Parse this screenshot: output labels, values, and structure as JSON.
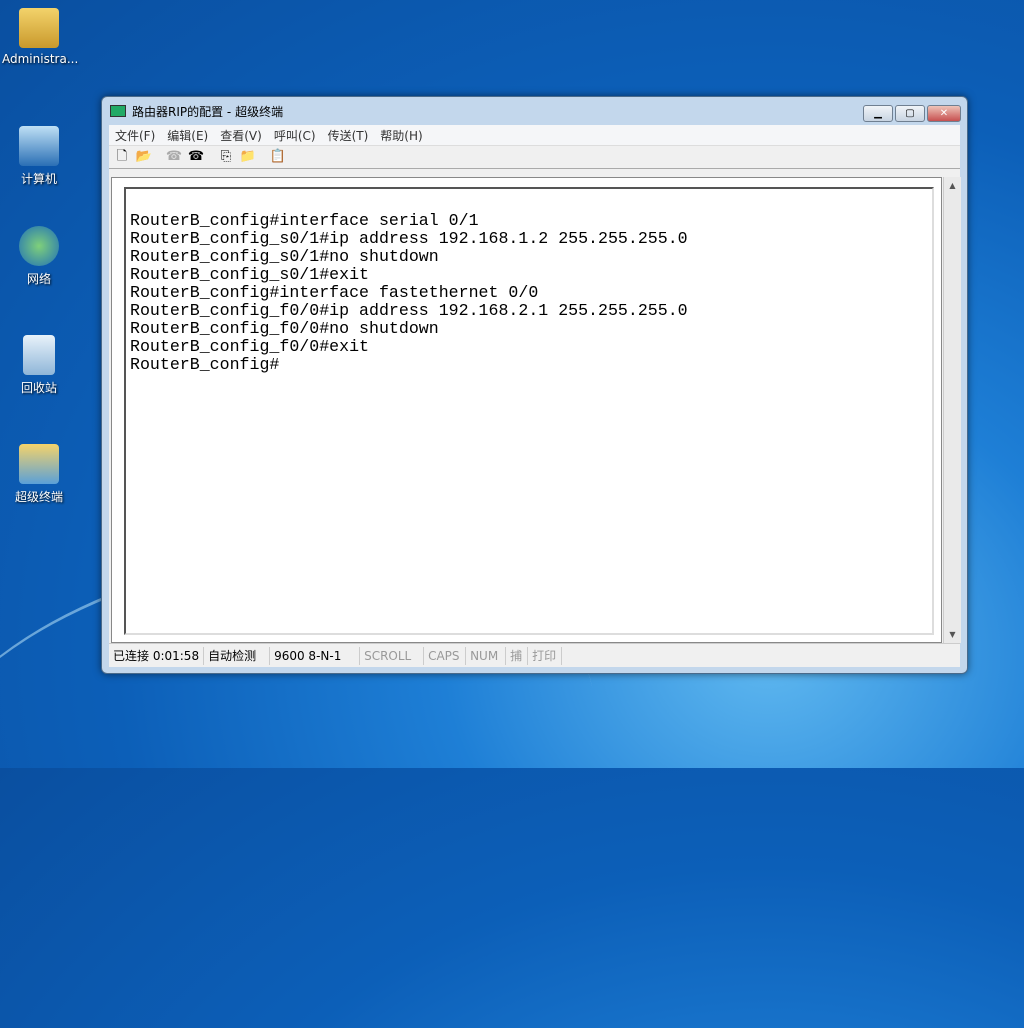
{
  "desktop": {
    "icons": [
      {
        "label": "Administra..."
      },
      {
        "label": "计算机"
      },
      {
        "label": "网络"
      },
      {
        "label": "回收站"
      },
      {
        "label": "超级终端"
      }
    ]
  },
  "window": {
    "title": "路由器RIP的配置 - 超级终端",
    "menu": [
      "文件(F)",
      "编辑(E)",
      "查看(V)",
      "呼叫(C)",
      "传送(T)",
      "帮助(H)"
    ],
    "toolbar": [
      "new-icon",
      "open-icon",
      "disconnect-icon",
      "dial-icon",
      "send-icon",
      "receive-icon",
      "properties-icon"
    ],
    "terminal_lines": [
      "RouterB_config#interface serial 0/1",
      "RouterB_config_s0/1#ip address 192.168.1.2 255.255.255.0",
      "RouterB_config_s0/1#no shutdown",
      "RouterB_config_s0/1#exit",
      "RouterB_config#interface fastethernet 0/0",
      "RouterB_config_f0/0#ip address 192.168.2.1 255.255.255.0",
      "RouterB_config_f0/0#no shutdown",
      "RouterB_config_f0/0#exit",
      "RouterB_config#"
    ],
    "status": {
      "connected": "已连接 0:01:58",
      "detect": "自动检测",
      "baud": "9600 8-N-1",
      "scroll": "SCROLL",
      "caps": "CAPS",
      "num": "NUM",
      "capture": "捕",
      "print": "打印"
    }
  }
}
